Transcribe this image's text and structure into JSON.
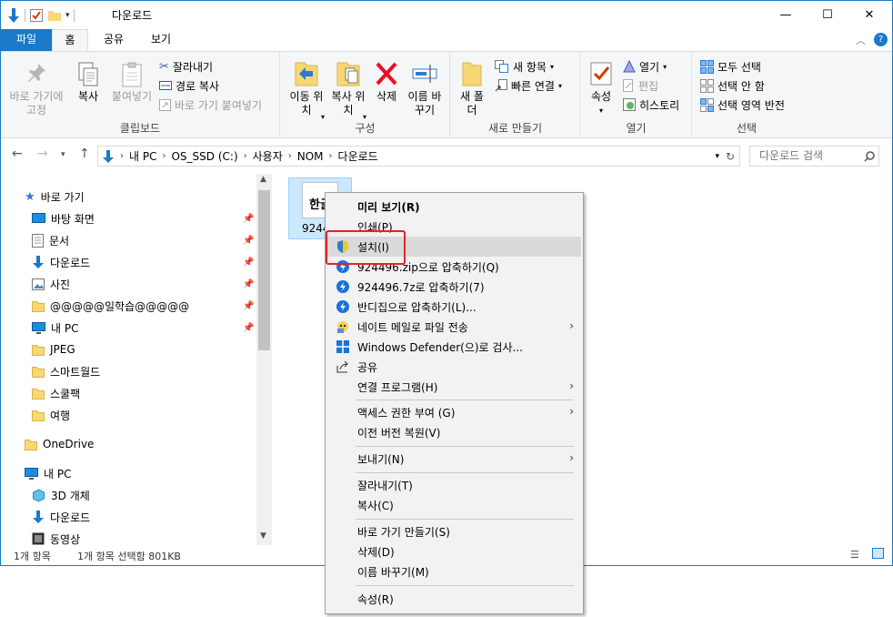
{
  "window": {
    "title": "다운로드",
    "controls": {
      "minimize": "—",
      "maximize": "☐",
      "close": "✕"
    }
  },
  "tabs": {
    "file": "파일",
    "home": "홈",
    "share": "공유",
    "view": "보기"
  },
  "ribbon": {
    "clipboard": {
      "label": "클립보드",
      "pin": "바로 가기에 고정",
      "copy": "복사",
      "paste": "붙여넣기",
      "cut": "잘라내기",
      "copy_path": "경로 복사",
      "paste_shortcut": "바로 가기 붙여넣기"
    },
    "organize": {
      "label": "구성",
      "move_to": "이동 위치",
      "copy_to": "복사 위치",
      "delete": "삭제",
      "rename": "이름 바꾸기"
    },
    "new": {
      "label": "새로 만들기",
      "new_folder": "새 폴더",
      "new_item": "새 항목",
      "easy_access": "빠른 연결"
    },
    "open": {
      "label": "열기",
      "properties": "속성",
      "open": "열기",
      "edit": "편집",
      "history": "히스토리"
    },
    "select": {
      "label": "선택",
      "select_all": "모두 선택",
      "select_none": "선택 안 함",
      "invert": "선택 영역 반전"
    }
  },
  "address": {
    "crumbs": [
      "내 PC",
      "OS_SSD (C:)",
      "사용자",
      "NOM",
      "다운로드"
    ],
    "search_placeholder": "다운로드 검색"
  },
  "nav": {
    "quick_access": "바로 가기",
    "items": [
      "바탕 화면",
      "문서",
      "다운로드",
      "사진",
      "@@@@@일학습@@@@@",
      "내 PC",
      "JPEG",
      "스마트월드",
      "스쿨팩",
      "여행"
    ],
    "onedrive": "OneDrive",
    "this_pc": "내 PC",
    "pc_items": [
      "3D 개체",
      "다운로드",
      "동영상"
    ]
  },
  "file": {
    "name_top": "한글",
    "name_bottom": "9244"
  },
  "status": {
    "count": "1개 항목",
    "selected": "1개 항목 선택함 801KB"
  },
  "context_menu": {
    "items": [
      "미리 보기(R)",
      "인쇄(P)",
      "설치(I)",
      "924496.zip으로 압축하기(Q)",
      "924496.7z로 압축하기(7)",
      "반디집으로 압축하기(L)...",
      "네이트 메일로 파일 전송",
      "Windows Defender(으)로 검사...",
      "공유",
      "연결 프로그램(H)",
      "액세스 권한 부여 (G)",
      "이전 버전 복원(V)",
      "보내기(N)",
      "잘라내기(T)",
      "복사(C)",
      "바로 가기 만들기(S)",
      "삭제(D)",
      "이름 바꾸기(M)",
      "속성(R)"
    ]
  },
  "colors": {
    "accent": "#1979ca",
    "highlight": "#e62222"
  }
}
